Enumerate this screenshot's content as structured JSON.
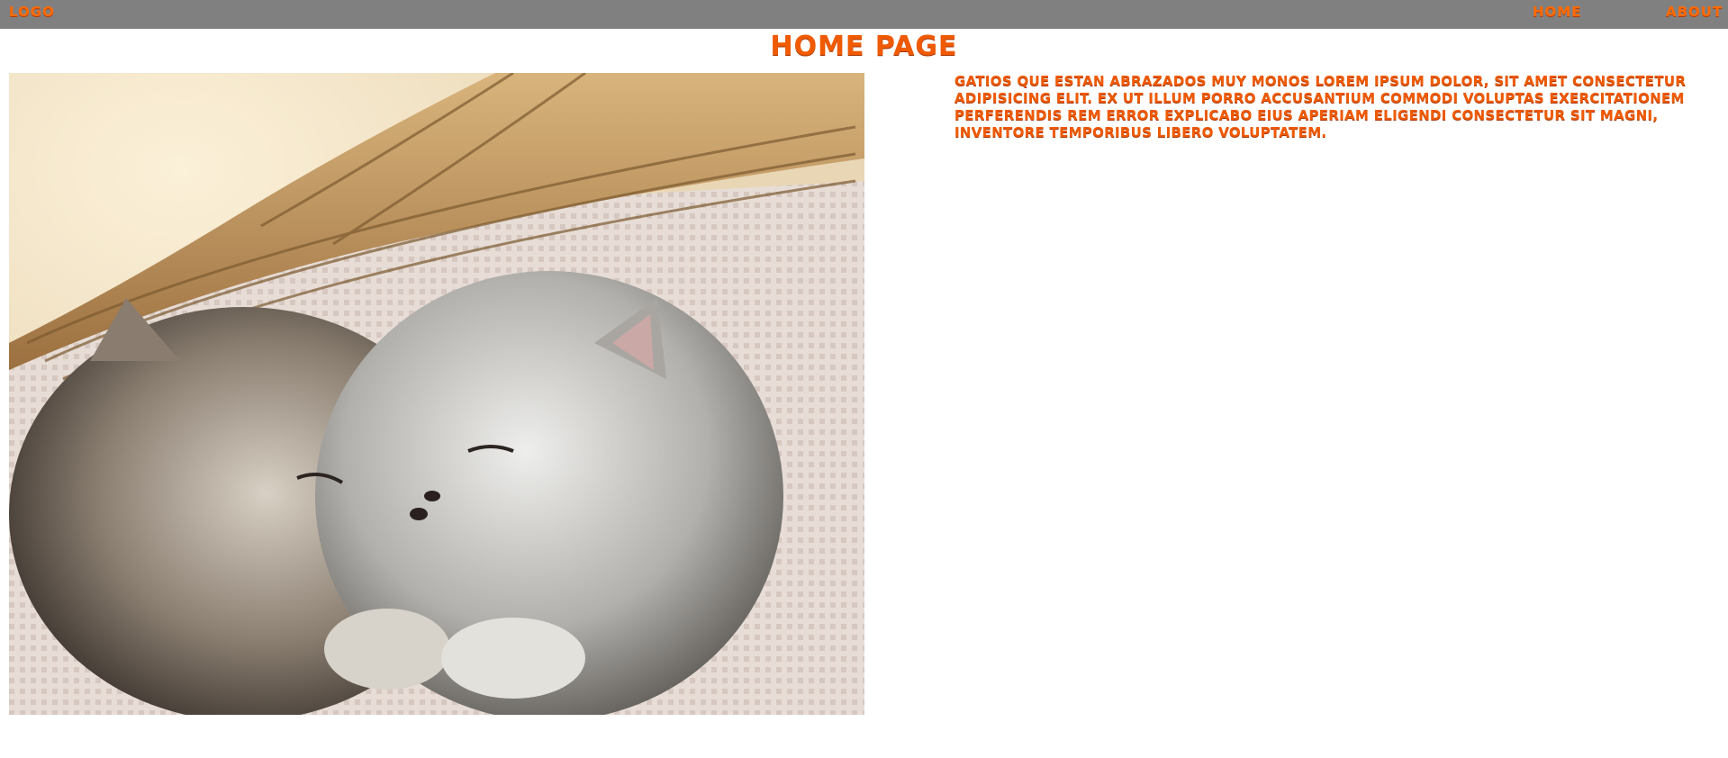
{
  "navbar": {
    "logo": "LOGO",
    "links": [
      {
        "label": "HOME"
      },
      {
        "label": "ABOUT"
      }
    ]
  },
  "page": {
    "title": "HOME PAGE",
    "description": "GATIOS QUE ESTAN ABRAZADOS MUY MONOS LOREM IPSUM DOLOR, SIT AMET CONSECTETUR ADIPISICING ELIT. EX UT ILLUM PORRO ACCUSANTIUM COMMODI VOLUPTAS EXERCITATIONEM PERFERENDIS REM ERROR EXPLICABO EIUS APERIAM ELIGENDI CONSECTETUR SIT MAGNI, INVENTORE TEMPORIBUS LIBERO VOLUPTATEM."
  },
  "colors": {
    "navbar_bg": "#808080",
    "accent": "#f05a00"
  }
}
